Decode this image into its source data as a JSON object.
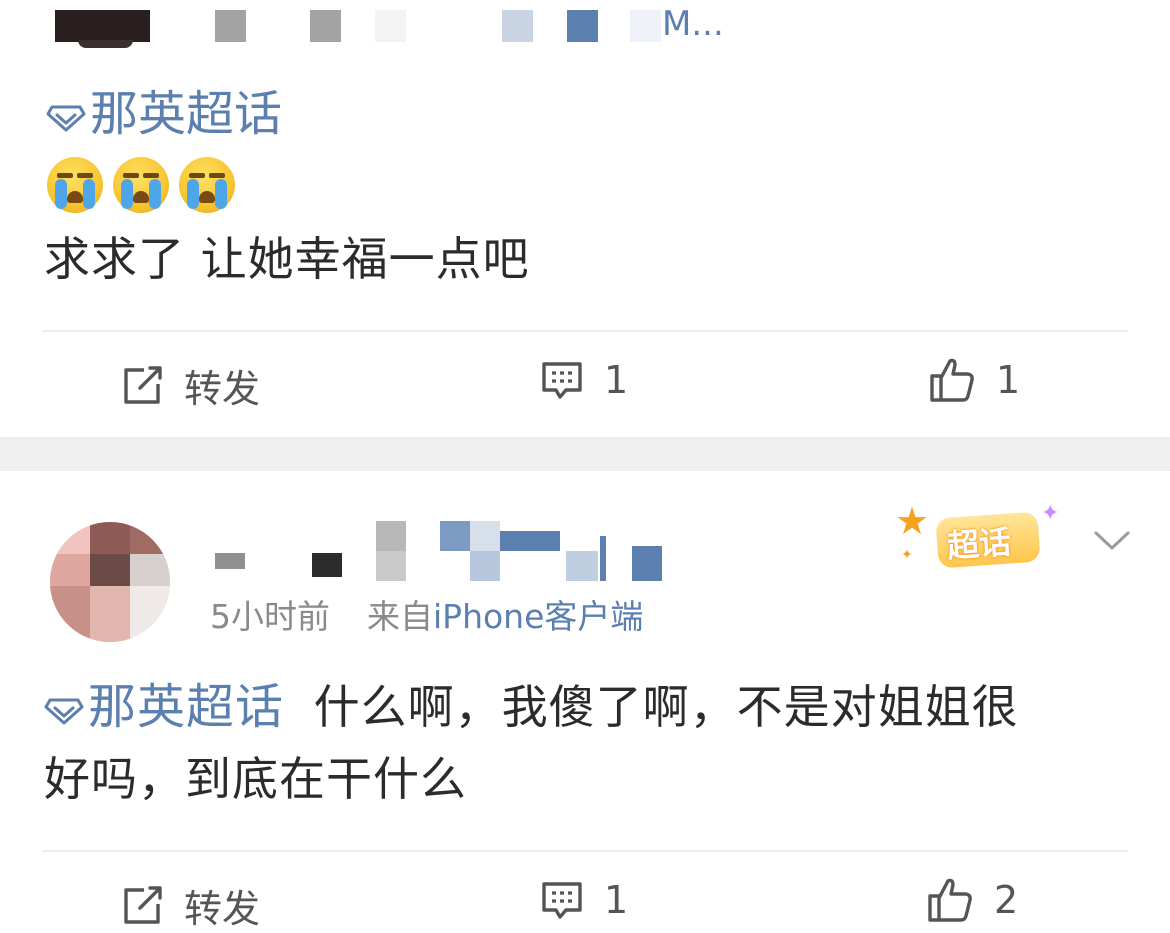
{
  "post1": {
    "username_fragment": "M...",
    "topic": "那英超话",
    "emoji_icons": [
      "crying-face-icon",
      "crying-face-icon",
      "crying-face-icon"
    ],
    "text": "求求了 让她幸福一点吧",
    "actions": {
      "repost_label": "转发",
      "comment_count": "1",
      "like_count": "1"
    }
  },
  "post2": {
    "time": "5小时前",
    "source_prefix": "来自",
    "source_client": "iPhone客户端",
    "badge_label": "超话",
    "topic": "那英超话",
    "text_line1": "什么啊，我傻了啊，不是对姐姐很",
    "text_line2": "好吗，到底在干什么",
    "actions": {
      "repost_label": "转发",
      "comment_count": "1",
      "like_count": "2"
    }
  },
  "colors": {
    "topic_link": "#5b7fae",
    "text": "#2b2b2b",
    "meta_gray": "#8a8a8a",
    "divider": "#eeeeee",
    "separator_band": "#f0f0f0"
  }
}
